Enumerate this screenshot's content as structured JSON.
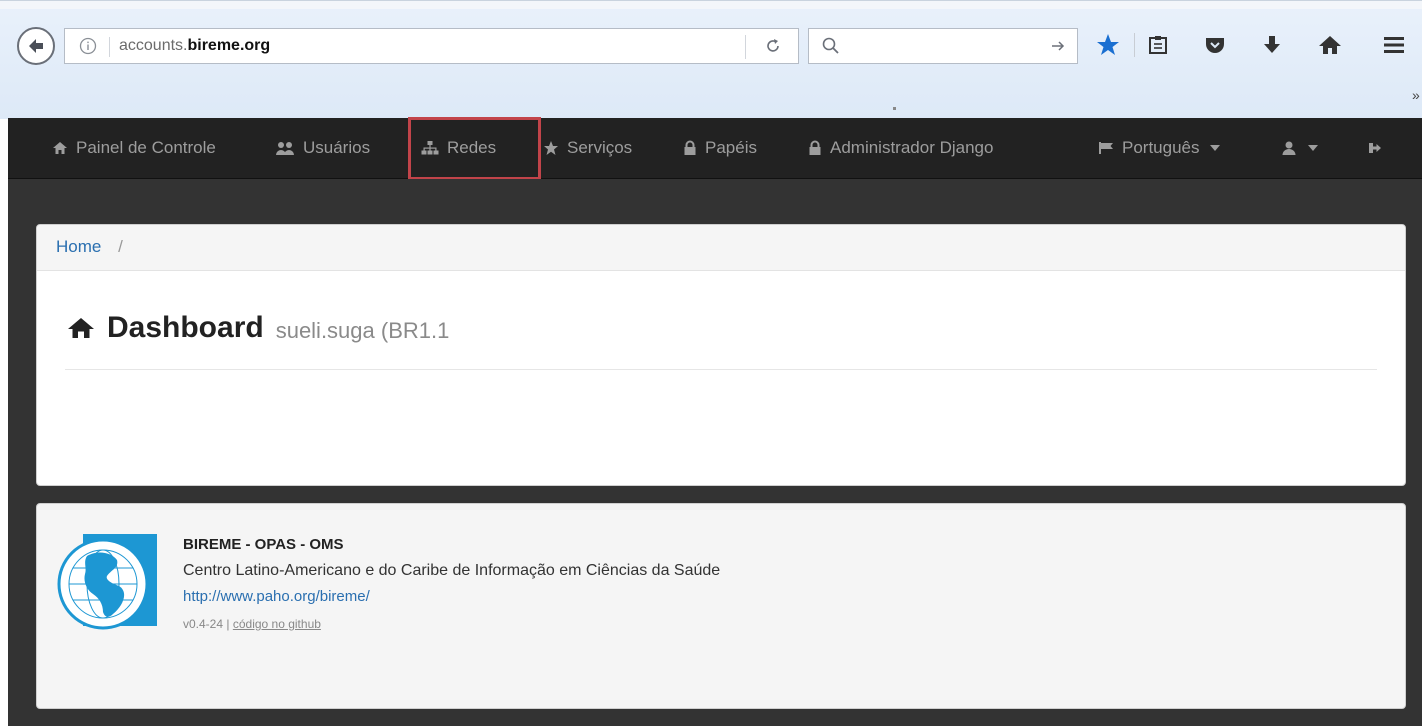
{
  "browser": {
    "url_prefix": "accounts.",
    "url_domain": "bireme.org",
    "search_placeholder": "",
    "icons": [
      "back-arrow-icon",
      "info-icon",
      "reload-icon",
      "search-icon",
      "go-arrow-icon",
      "bookmark-star-icon",
      "reading-list-icon",
      "pocket-icon",
      "download-icon",
      "home-icon",
      "menu-icon"
    ],
    "star_color": "#1a6fd1",
    "overflow_glyph": "»"
  },
  "navbar": {
    "items": [
      {
        "label": "Painel de Controle",
        "icon": "home-icon"
      },
      {
        "label": "Usuários",
        "icon": "users-icon"
      },
      {
        "label": "Redes",
        "icon": "sitemap-icon"
      },
      {
        "label": "Serviços",
        "icon": "star-icon"
      },
      {
        "label": "Papéis",
        "icon": "lock-icon"
      },
      {
        "label": "Administrador Django",
        "icon": "lock-icon"
      }
    ],
    "language": {
      "label": "Português",
      "icon": "flag-icon"
    },
    "user_icon": "user-icon",
    "logout_icon": "sign-out-icon",
    "highlight_color": "#c2444a"
  },
  "breadcrumb": {
    "home": "Home",
    "separator": "/"
  },
  "page": {
    "title": "Dashboard",
    "subtitle": "sueli.suga (BR1.1"
  },
  "footer": {
    "org": "BIREME - OPAS - OMS",
    "description": "Centro Latino-Americano e do Caribe de Informação em Ciências da Saúde",
    "link": "http://www.paho.org/bireme/",
    "version": "v0.4-24",
    "version_sep": "|",
    "github_link": "código no github",
    "logo_text": "BIREME · OPAS · OMS"
  }
}
